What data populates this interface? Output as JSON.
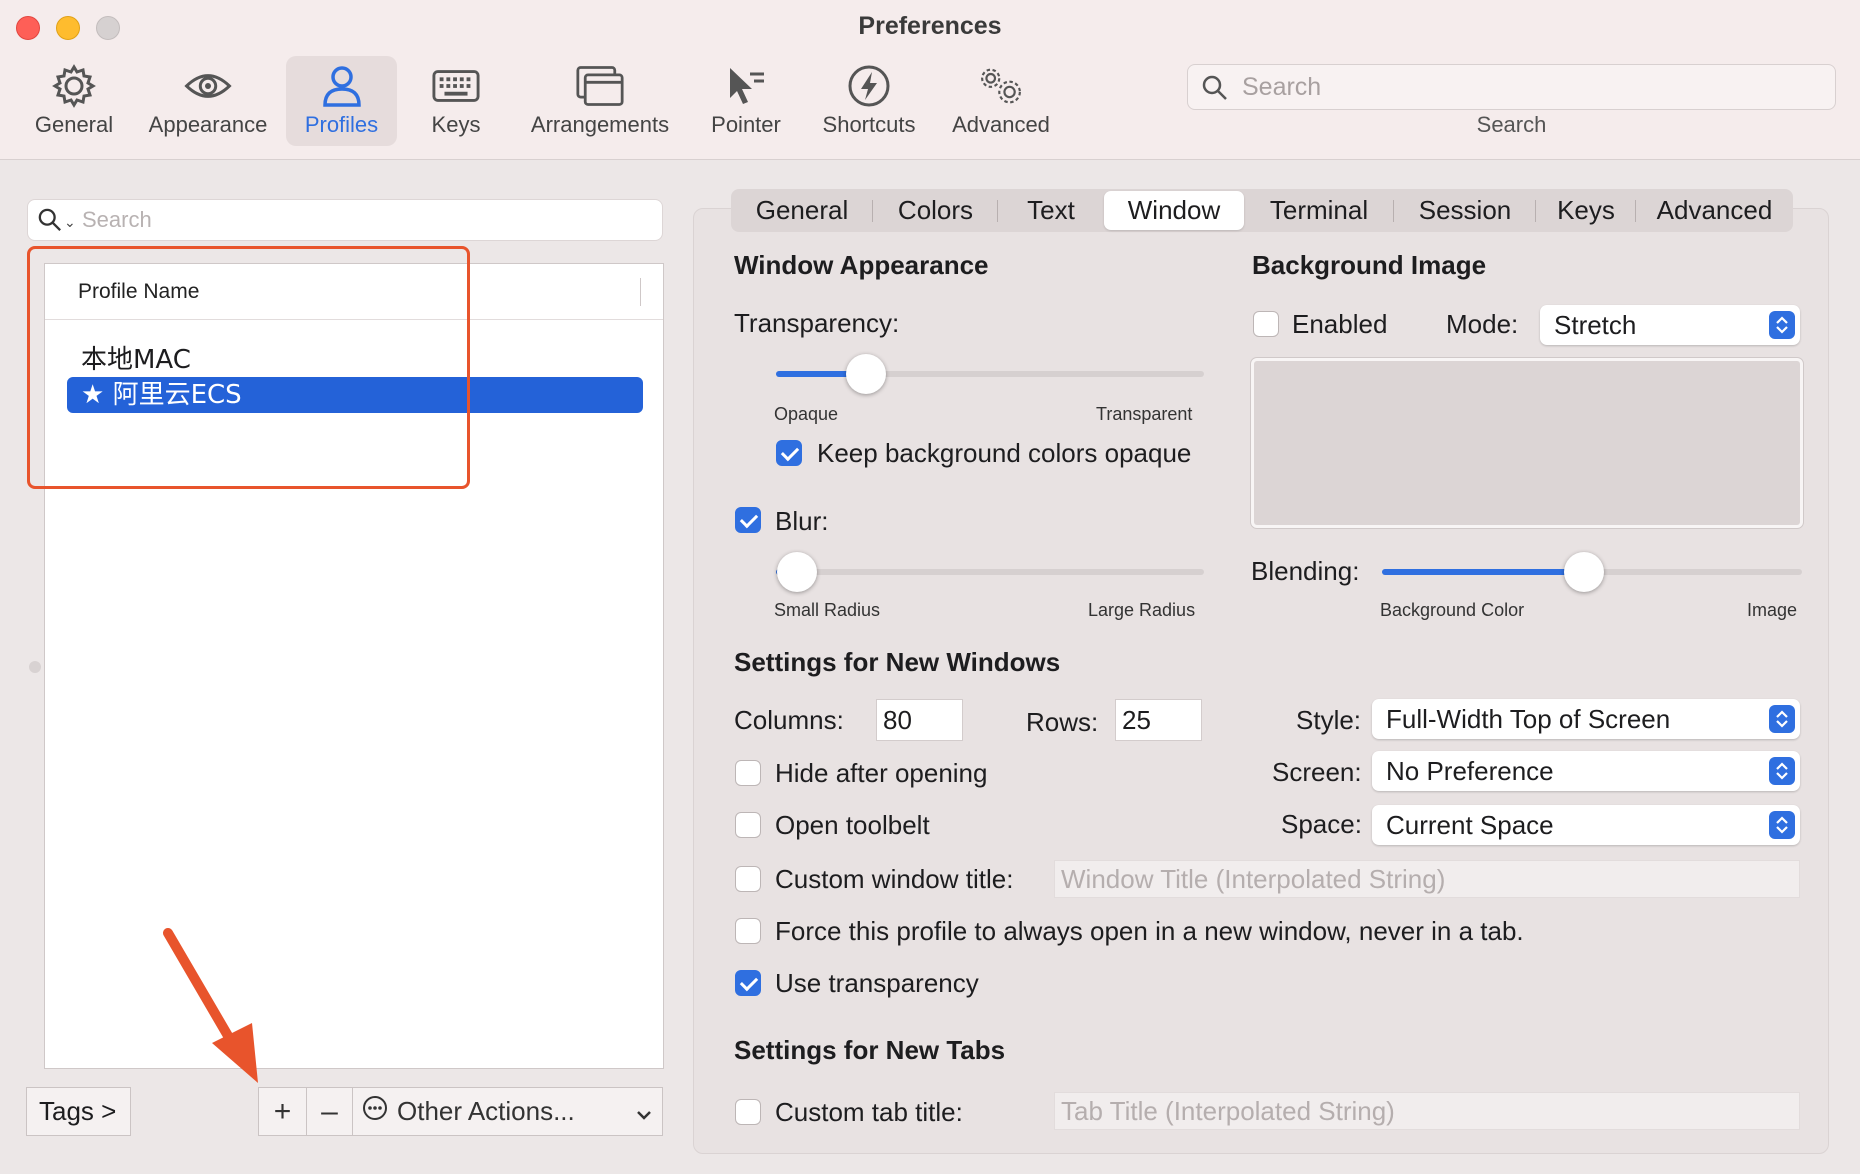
{
  "window": {
    "title": "Preferences"
  },
  "toolbar": {
    "items": [
      {
        "label": "General",
        "icon": "gear-icon"
      },
      {
        "label": "Appearance",
        "icon": "eye-icon"
      },
      {
        "label": "Profiles",
        "icon": "person-icon",
        "active": true
      },
      {
        "label": "Keys",
        "icon": "keyboard-icon"
      },
      {
        "label": "Arrangements",
        "icon": "windows-icon"
      },
      {
        "label": "Pointer",
        "icon": "pointer-icon"
      },
      {
        "label": "Shortcuts",
        "icon": "bolt-icon"
      },
      {
        "label": "Advanced",
        "icon": "gears-icon"
      }
    ],
    "search_placeholder": "Search",
    "search_caption": "Search"
  },
  "left": {
    "search_placeholder": "Search",
    "column_header": "Profile Name",
    "profiles": [
      {
        "name": "本地MAC",
        "selected": false
      },
      {
        "name": "★ 阿里云ECS",
        "selected": true
      }
    ],
    "tags_button": "Tags >",
    "add_symbol": "+",
    "remove_symbol": "–",
    "other_actions": "Other Actions...",
    "other_icon": "ellipsis-circle-icon"
  },
  "tabs": [
    "General",
    "Colors",
    "Text",
    "Window",
    "Terminal",
    "Session",
    "Keys",
    "Advanced"
  ],
  "active_tab": "Window",
  "window_appearance": {
    "title": "Window Appearance",
    "transparency_label": "Transparency:",
    "transparency_value": 0.21,
    "opaque_label": "Opaque",
    "transparent_label": "Transparent",
    "keep_bg_opaque_label": "Keep background colors opaque",
    "keep_bg_opaque": true,
    "blur_label": "Blur:",
    "blur": true,
    "blur_value": 0.05,
    "small_radius_label": "Small Radius",
    "large_radius_label": "Large Radius"
  },
  "background_image": {
    "title": "Background Image",
    "enabled_label": "Enabled",
    "enabled": false,
    "mode_label": "Mode:",
    "mode_value": "Stretch",
    "blending_label": "Blending:",
    "blending_value": 0.48,
    "bg_color_label": "Background Color",
    "image_label": "Image"
  },
  "new_windows": {
    "title": "Settings for New Windows",
    "columns_label": "Columns:",
    "columns_value": "80",
    "rows_label": "Rows:",
    "rows_value": "25",
    "style_label": "Style:",
    "style_value": "Full-Width Top of Screen",
    "screen_label": "Screen:",
    "screen_value": "No Preference",
    "space_label": "Space:",
    "space_value": "Current Space",
    "hide_after_opening_label": "Hide after opening",
    "open_toolbelt_label": "Open toolbelt",
    "custom_window_title_label": "Custom window title:",
    "window_title_placeholder": "Window Title (Interpolated String)",
    "force_new_window_label": "Force this profile to always open in a new window, never in a tab.",
    "use_transparency_label": "Use transparency",
    "use_transparency": true
  },
  "new_tabs": {
    "title": "Settings for New Tabs",
    "custom_tab_title_label": "Custom tab title:",
    "tab_title_placeholder": "Tab Title (Interpolated String)"
  },
  "colors": {
    "accent": "#2F6FE0",
    "selection": "#2462D8",
    "annotation": "#E8542C"
  }
}
